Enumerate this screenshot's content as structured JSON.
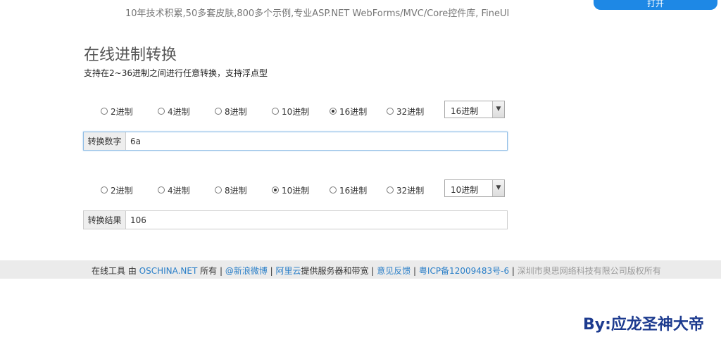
{
  "banner": {
    "text": "10年技术积累,50多套皮肤,800多个示例,专业ASP.NET WebForms/MVC/Core控件库, FineUI",
    "button_label": "打开"
  },
  "page": {
    "title": "在线进制转换",
    "subtitle": "支持在2~36进制之间进行任意转换，支持浮点型"
  },
  "input_section": {
    "bases": [
      {
        "label": "2进制",
        "checked": false
      },
      {
        "label": "4进制",
        "checked": false
      },
      {
        "label": "8进制",
        "checked": false
      },
      {
        "label": "10进制",
        "checked": false
      },
      {
        "label": "16进制",
        "checked": true
      },
      {
        "label": "32进制",
        "checked": false
      }
    ],
    "select_value": "16进制",
    "addon_label": "转换数字",
    "value": "6a"
  },
  "output_section": {
    "bases": [
      {
        "label": "2进制",
        "checked": false
      },
      {
        "label": "4进制",
        "checked": false
      },
      {
        "label": "8进制",
        "checked": false
      },
      {
        "label": "10进制",
        "checked": true
      },
      {
        "label": "16进制",
        "checked": false
      },
      {
        "label": "32进制",
        "checked": false
      }
    ],
    "select_value": "10进制",
    "addon_label": "转换结果",
    "value": "106"
  },
  "footer": {
    "prefix": "在线工具 由 ",
    "oschina_link": "OSCHINA.NET",
    "owns": " 所有 | ",
    "weibo_link": "@新浪微博",
    "sep1": " | ",
    "aliyun_link": "阿里云",
    "aliyun_suffix": "提供服务器和带宽 | ",
    "feedback_link": "意见反馈",
    "sep2": " | ",
    "icp_link": "粤ICP备12009483号-6",
    "sep3": " | ",
    "copyright": "深圳市奥思网络科技有限公司版权所有"
  },
  "watermark": "By:应龙圣神大帝"
}
